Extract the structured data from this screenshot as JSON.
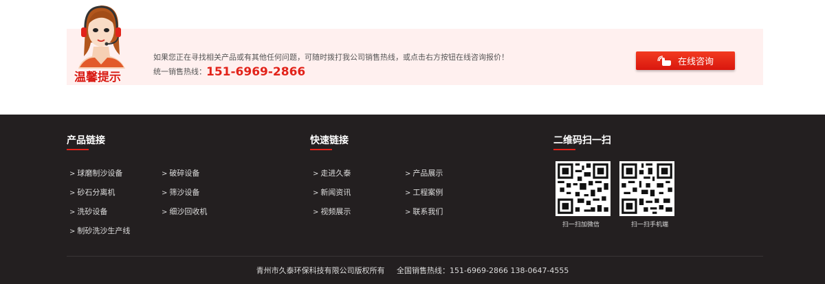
{
  "notice": {
    "title": "温馨提示",
    "message": "如果您正在寻找相关产品或有其他任何问题，可随时拨打我公司销售热线，或点击右方按钮在线咨询报价！",
    "hotline_label": "统一销售热线：",
    "hotline_number": "151-6969-2866",
    "consult_button": "在线咨询",
    "accent_color": "#e2231a",
    "banner_bg": "#fff0ef"
  },
  "footer": {
    "product_links": {
      "title": "产品链接",
      "items": [
        "球磨制沙设备",
        "破碎设备",
        "砂石分离机",
        "筛沙设备",
        "洗砂设备",
        "细沙回收机",
        "制砂洗沙生产线"
      ]
    },
    "quick_links": {
      "title": "快速链接",
      "items": [
        "走进久泰",
        "产品展示",
        "新闻资讯",
        "工程案例",
        "视频展示",
        "联系我们"
      ]
    },
    "qr": {
      "title": "二维码扫一扫",
      "captions": [
        "扫一扫加微信",
        "扫一扫手机端"
      ]
    },
    "arrow_glyph": ">",
    "copyright": "青州市久泰环保科技有限公司版权所有     全国销售热线：151-6969-2866 138-0647-4555",
    "bg_color": "#231f20"
  }
}
